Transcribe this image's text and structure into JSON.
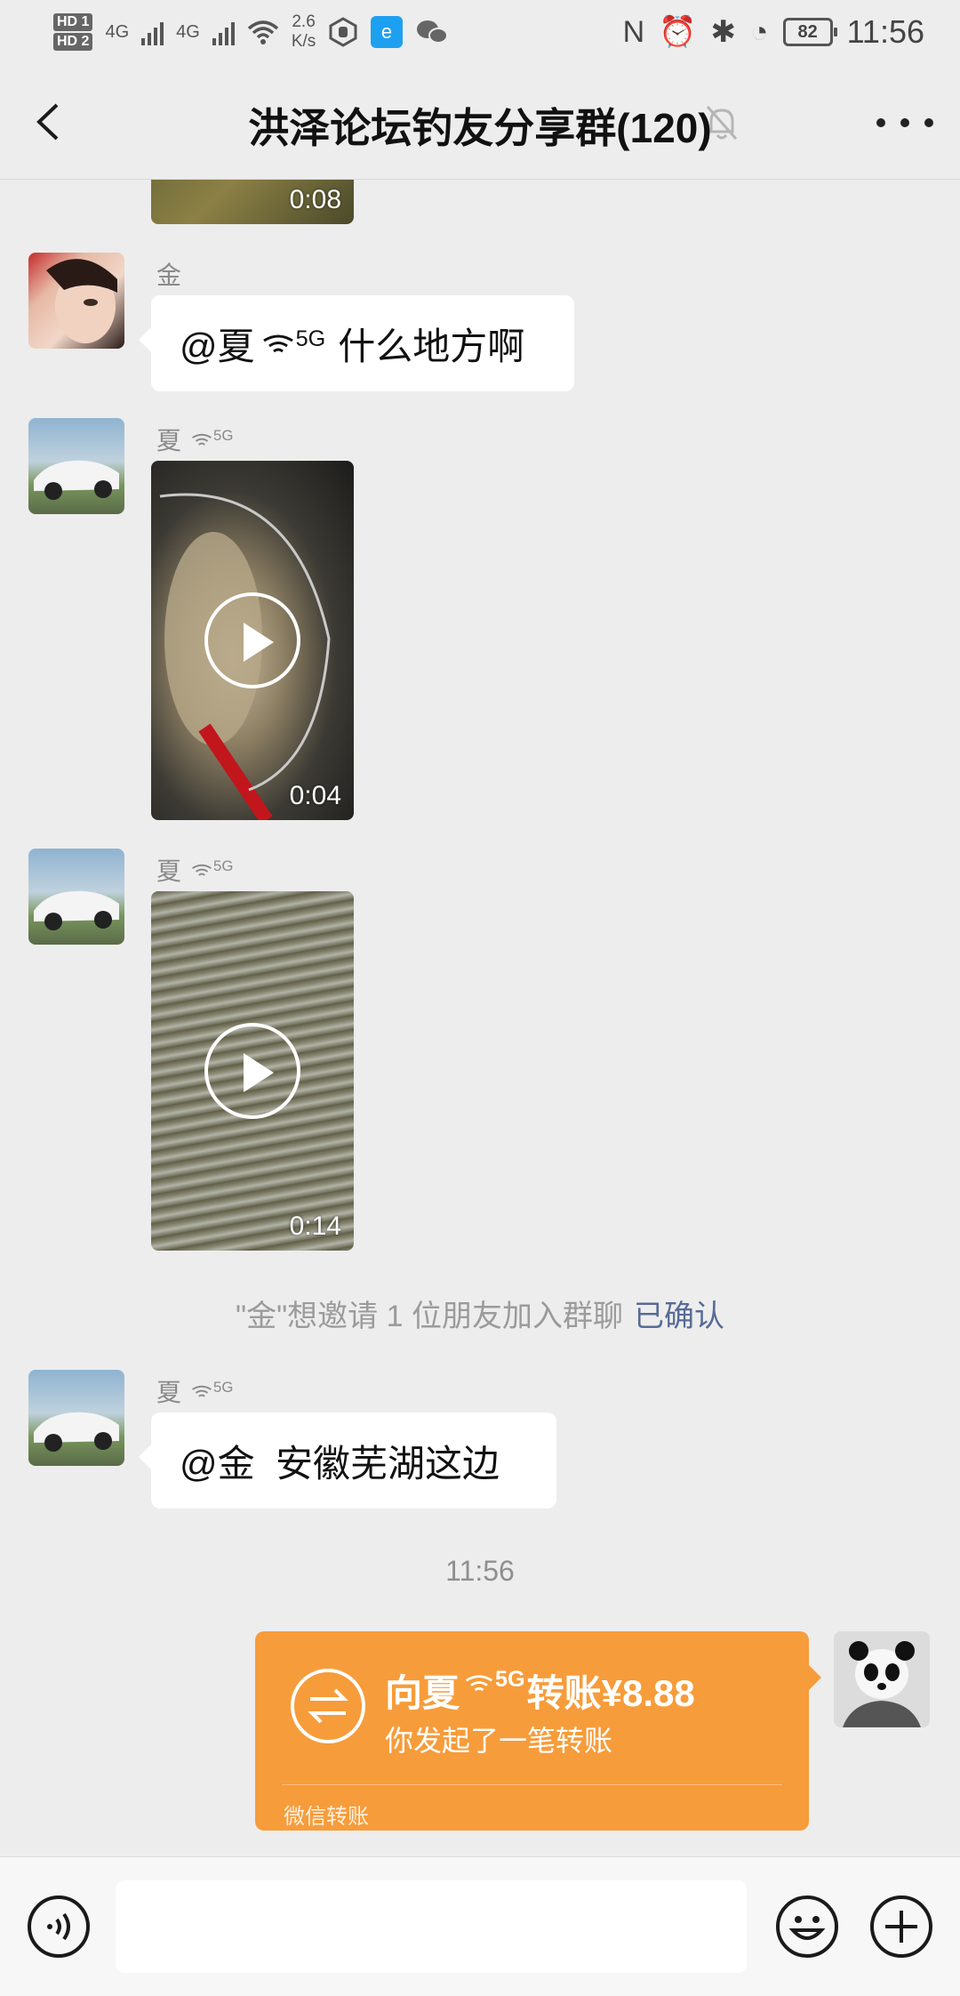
{
  "status_bar": {
    "sim1": "HD 1",
    "sim2": "HD 2",
    "net1": "4G",
    "net2": "4G",
    "speed_value": "2.6",
    "speed_unit": "K/s",
    "battery": "82",
    "time": "11:56"
  },
  "header": {
    "title": "洪泽论坛钓友分享群(120)",
    "back_icon": "chevron-left-icon",
    "mute_icon": "bell-off-icon",
    "more_icon": "more-dots-icon"
  },
  "messages": {
    "top_video": {
      "duration": "0:08"
    },
    "m1": {
      "sender": "金",
      "text_prefix": "@夏",
      "sup": "5G",
      "text_suffix": "什么地方啊"
    },
    "m2": {
      "sender": "夏",
      "sup": "5G",
      "duration": "0:04"
    },
    "m3": {
      "sender": "夏",
      "sup": "5G",
      "duration": "0:14"
    },
    "system": {
      "text": "\"金\"想邀请 1 位朋友加入群聊",
      "link": "已确认"
    },
    "m4": {
      "sender": "夏",
      "sup": "5G",
      "text": "@金  安徽芜湖这边"
    },
    "timestamp": "11:56",
    "transfer": {
      "title_prefix": "向夏",
      "sup": "5G",
      "title_suffix": "转账¥8.88",
      "subtitle": "你发起了一笔转账",
      "footer": "微信转账"
    }
  },
  "input_bar": {
    "voice_icon": "voice-icon",
    "emoji_icon": "emoji-icon",
    "plus_icon": "plus-icon",
    "input_value": ""
  },
  "colors": {
    "background": "#ededed",
    "bubble": "#ffffff",
    "transfer": "#f79c3a",
    "link": "#576b95"
  }
}
